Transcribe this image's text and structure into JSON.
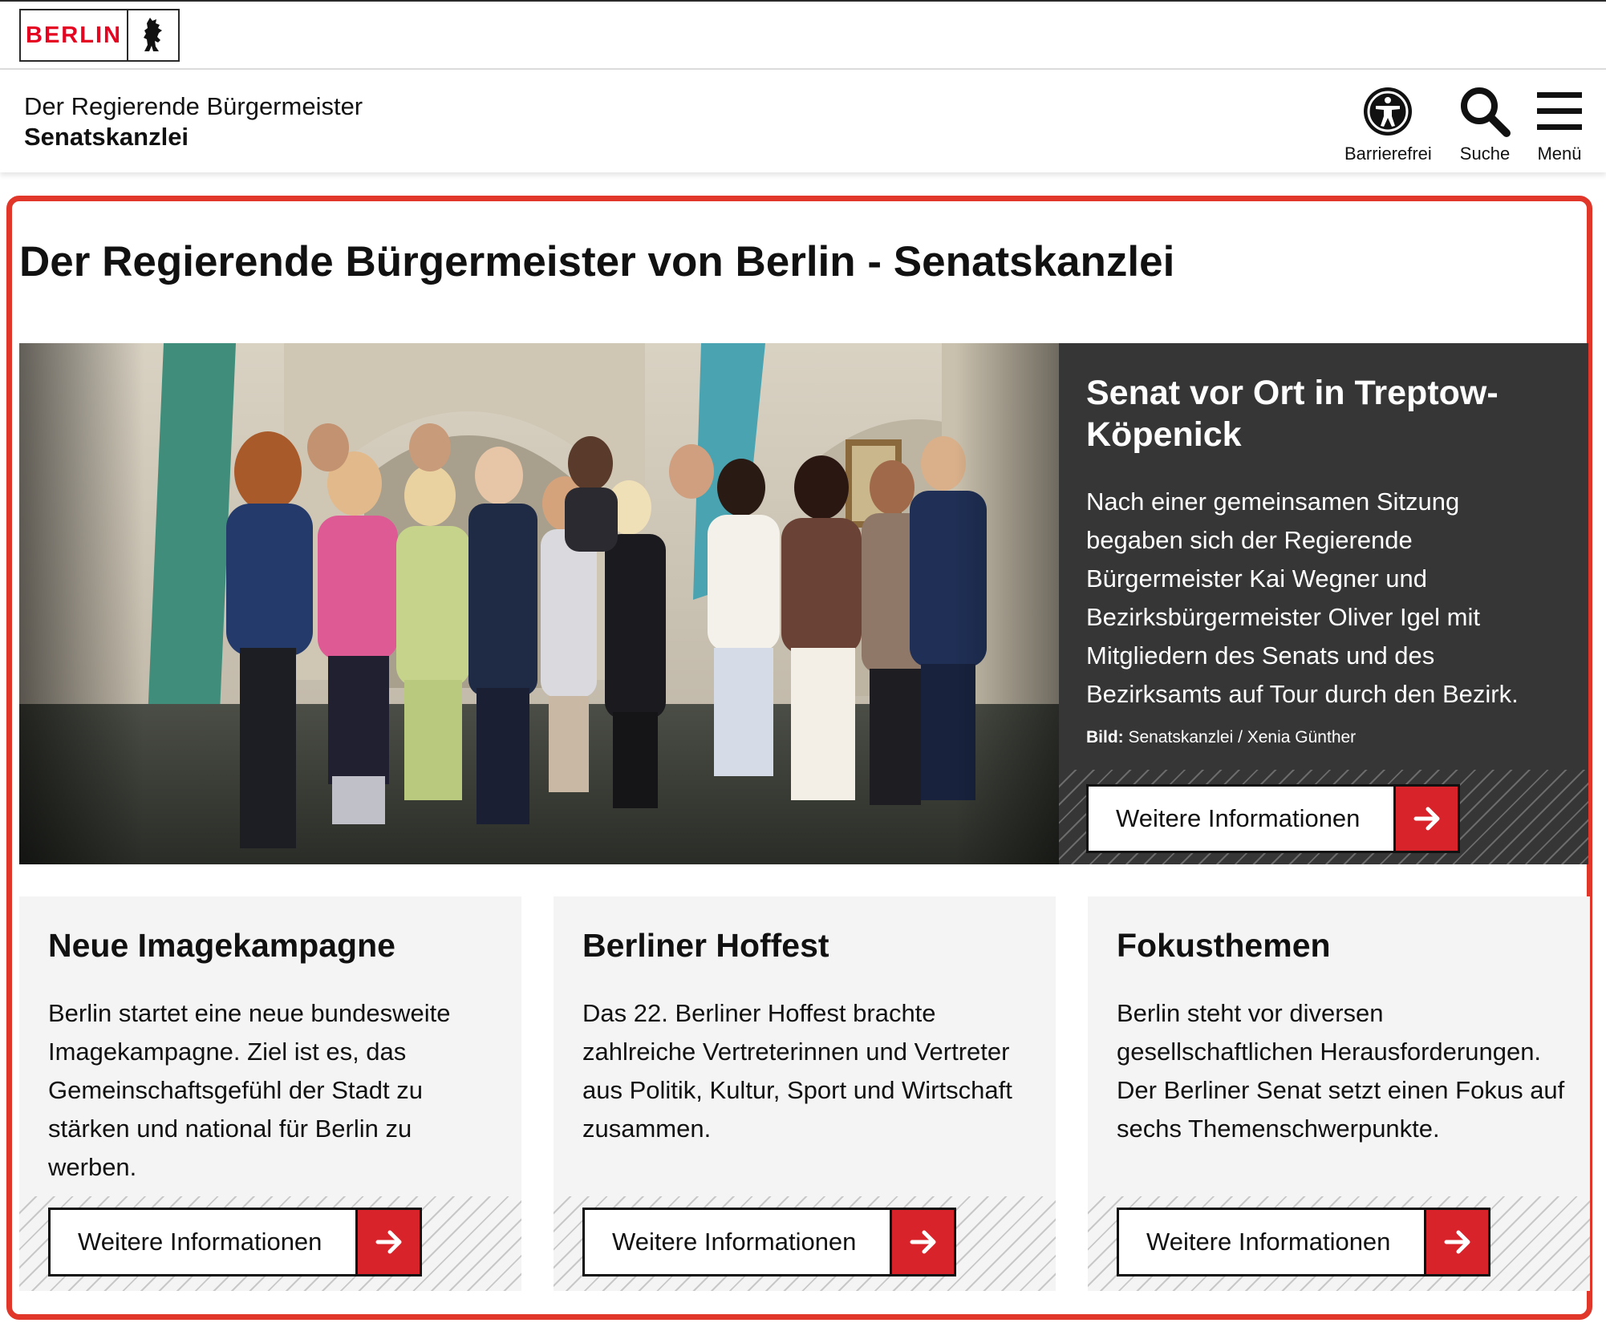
{
  "logo": {
    "text": "BERLIN",
    "icon": "berlin-bear-icon"
  },
  "header": {
    "title": "Der Regierende Bürgermeister",
    "subtitle": "Senatskanzlei",
    "tools": [
      {
        "label": "Barrierefrei",
        "icon": "accessibility-icon"
      },
      {
        "label": "Suche",
        "icon": "search-icon"
      },
      {
        "label": "Menü",
        "icon": "menu-icon"
      }
    ]
  },
  "page": {
    "title": "Der Regierende Bürgermeister von Berlin - Senatskanzlei"
  },
  "hero": {
    "image_alt": "Gruppenfoto Senat und Bezirksamt in Treptow-Köpenick",
    "heading": "Senat vor Ort in Treptow-Köpenick",
    "text": "Nach einer gemeinsamen Sitzung begaben sich der Regierende Bürgermeister Kai Wegner und Bezirksbürgermeister Oliver Igel mit Mitgliedern des Senats und des Bezirksamts auf Tour durch den Bezirk.",
    "credit_label": "Bild:",
    "credit_value": " Senatskanzlei / Xenia Günther",
    "button_label": "Weitere Informationen"
  },
  "cards": [
    {
      "title": "Neue Imagekampagne",
      "text": "Berlin startet eine neue bundesweite Imagekampagne. Ziel ist es, das Gemeinschaftsgefühl der Stadt zu stärken und national für Berlin zu werben.",
      "button_label": "Weitere Informationen"
    },
    {
      "title": "Berliner Hoffest",
      "text": "Das 22. Berliner Hoffest brachte zahlreiche Vertreterinnen und Vertreter aus Politik, Kultur, Sport und Wirtschaft zusammen.",
      "button_label": "Weitere Informationen"
    },
    {
      "title": "Fokusthemen",
      "text": "Berlin steht vor diversen gesellschaftlichen Herausforderungen. Der Berliner Senat setzt einen Fokus auf sechs Themenschwerpunkte.",
      "button_label": "Weitere Informationen"
    }
  ],
  "colors": {
    "brand_red": "#e40422",
    "button_red": "#d8232a",
    "highlight_frame": "#e0372a",
    "hero_panel": "#363636",
    "card_bg": "#f4f4f4"
  }
}
